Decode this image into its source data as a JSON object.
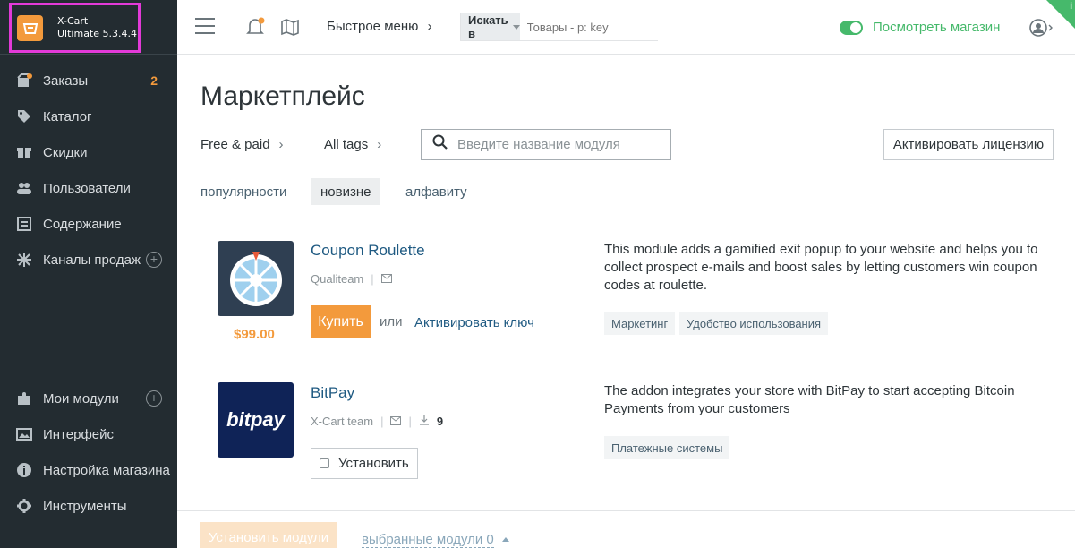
{
  "app": {
    "brand_name": "X-Cart",
    "brand_version": "Ultimate 5.3.4.4"
  },
  "sidebar": {
    "items": [
      {
        "label": "Заказы",
        "icon": "orders-icon",
        "count": "2"
      },
      {
        "label": "Каталог",
        "icon": "tag-icon"
      },
      {
        "label": "Скидки",
        "icon": "gift-icon"
      },
      {
        "label": "Пользователи",
        "icon": "users-icon"
      },
      {
        "label": "Содержание",
        "icon": "content-icon"
      },
      {
        "label": "Каналы продаж",
        "icon": "sales-channels-icon",
        "plus": "+"
      },
      {
        "label": "Мои модули",
        "icon": "puzzle-icon",
        "plus": "+"
      },
      {
        "label": "Интерфейс",
        "icon": "image-icon"
      },
      {
        "label": "Настройка магазина",
        "icon": "info-icon"
      },
      {
        "label": "Инструменты",
        "icon": "gear-icon"
      }
    ]
  },
  "header": {
    "quick_menu": "Быстрое меню",
    "search_in": "Искать в",
    "search_placeholder": "Товары - p: key",
    "view_store": "Посмотреть магазин",
    "info_badge": "i"
  },
  "main": {
    "title": "Маркетплейс",
    "filters": {
      "price": "Free & paid",
      "tags": "All tags"
    },
    "module_search_placeholder": "Введите название модуля",
    "activate_license": "Активировать лицензию",
    "sort_tabs": [
      {
        "label": "популярности",
        "active": false
      },
      {
        "label": "новизне",
        "active": true
      },
      {
        "label": "алфавиту",
        "active": false
      }
    ],
    "modules": [
      {
        "name": "Coupon Roulette",
        "author": "Qualiteam",
        "price": "$99.00",
        "buy_label": "Купить",
        "or_label": "или",
        "activate_key": "Активировать ключ",
        "description": "This module adds a gamified exit popup to your website and helps you to collect prospect e-mails and boost sales by letting customers win coupon codes at roulette.",
        "tags": [
          "Маркетинг",
          "Удобство использования"
        ]
      },
      {
        "name": "BitPay",
        "author": "X-Cart team",
        "downloads": "9",
        "logo_text": "bitpay",
        "install_label": "Установить",
        "description": "The addon integrates your store with BitPay to start accepting Bitcoin Payments from your customers",
        "tags": [
          "Платежные системы"
        ]
      }
    ]
  },
  "footer": {
    "install_modules": "Установить модули",
    "selected_modules": "выбранные модули 0"
  },
  "colors": {
    "sidebar_bg": "#232c31",
    "accent_orange": "#f39a3c",
    "store_green": "#46b96b",
    "link_blue": "#1f5a82"
  }
}
